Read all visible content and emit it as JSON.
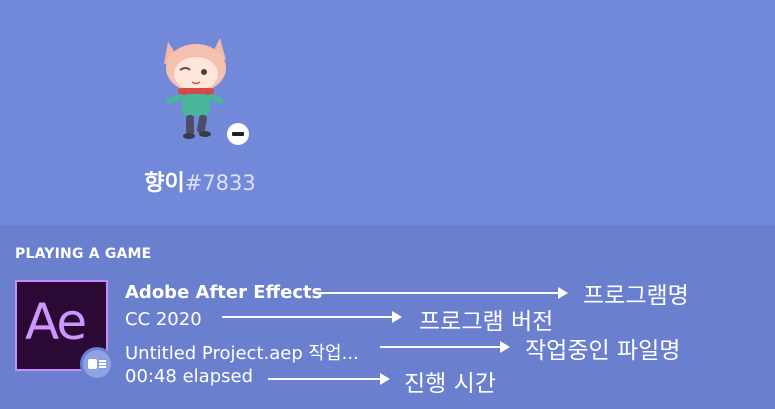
{
  "profile": {
    "name": "향이",
    "discriminator": "#7833",
    "status": "do-not-disturb"
  },
  "activity": {
    "section_title": "PLAYING A GAME",
    "app_icon_text": "Ae",
    "app_name": "Adobe After Effects",
    "version": "CC 2020",
    "file": "Untitled Project.aep 작업...",
    "elapsed": "00:48 elapsed"
  },
  "annotations": {
    "program_name": "프로그램명",
    "program_version": "프로그램 버전",
    "working_file": "작업중인 파일명",
    "elapsed_time": "진행 시간"
  }
}
